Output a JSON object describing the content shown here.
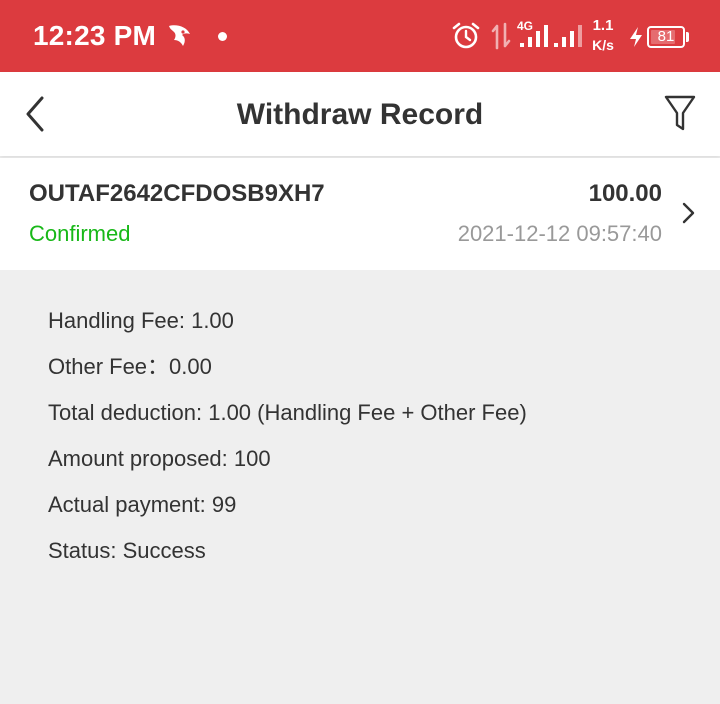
{
  "status_bar": {
    "time": "12:23 PM",
    "network_type": "4G",
    "speed_value": "1.1",
    "speed_unit": "K/s",
    "battery_level": "81",
    "battery_fraction": 0.81,
    "background_color": "#dc3b3f",
    "icons": [
      "app-notification-icon",
      "alarm-icon",
      "data-arrows-icon",
      "signal-icon",
      "signal-icon",
      "charging-icon",
      "battery-icon"
    ]
  },
  "header": {
    "title": "Withdraw Record",
    "back_icon": "chevron-left-icon",
    "filter_icon": "filter-icon"
  },
  "record": {
    "order_id": "OUTAF2642CFDOSB9XH7",
    "amount": "100.00",
    "status": "Confirmed",
    "status_color": "#18b818",
    "datetime": "2021-12-12 09:57:40",
    "expand_icon": "chevron-right-icon"
  },
  "details": {
    "handling_fee": "Handling Fee: 1.00",
    "other_fee": "Other Fee：0.00",
    "total_deduction": "Total deduction: 1.00 (Handling Fee + Other Fee)",
    "amount_proposed": "Amount proposed: 100",
    "actual_payment": "Actual payment: 99",
    "status": "Status: Success"
  }
}
